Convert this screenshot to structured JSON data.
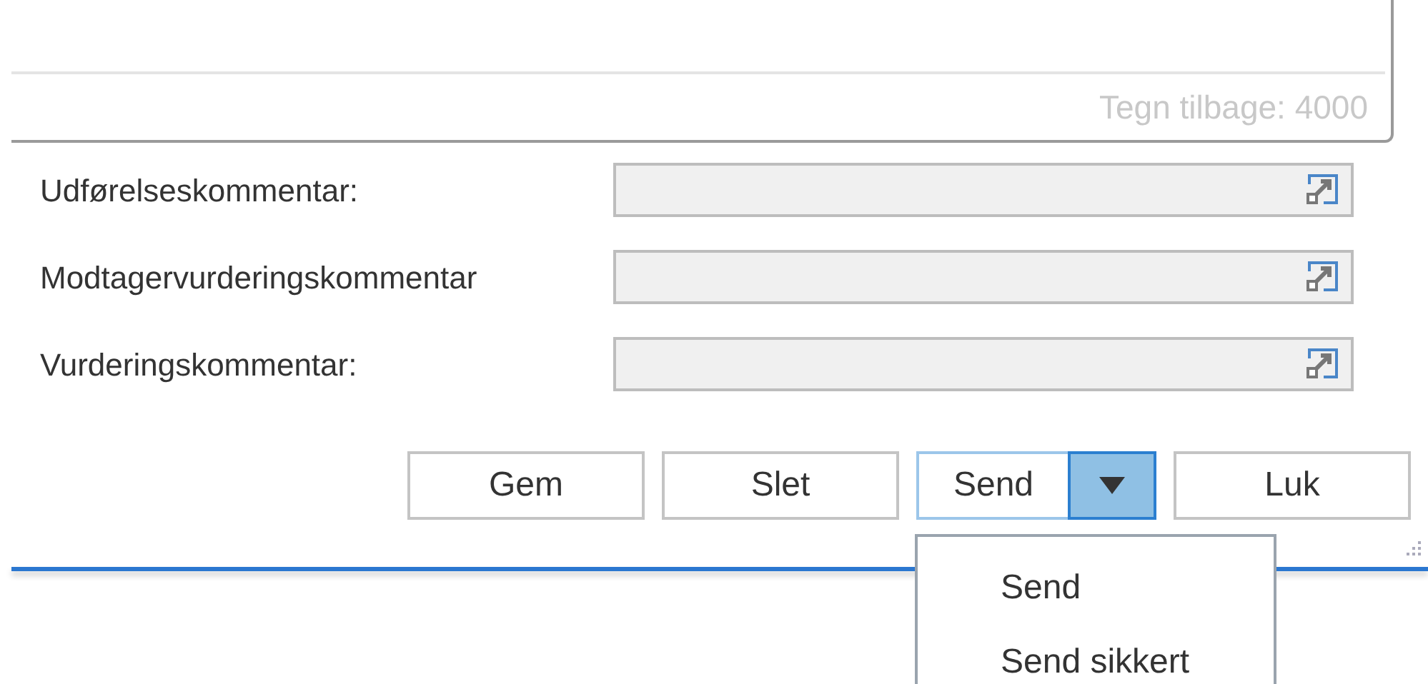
{
  "comment_box": {
    "counter": "Tegn tilbage: 4000"
  },
  "fields": [
    {
      "label": "Udførelseskommentar:"
    },
    {
      "label": "Modtagervurderingskommentar"
    },
    {
      "label": "Vurderingskommentar:"
    }
  ],
  "buttons": [
    {
      "kind": "plain",
      "label": "Gem"
    },
    {
      "kind": "plain",
      "label": "Slet"
    },
    {
      "kind": "split",
      "label": "Send",
      "expanded": true
    },
    {
      "kind": "plain",
      "label": "Luk"
    }
  ],
  "send_menu": {
    "items": [
      {
        "label": "Send"
      },
      {
        "label": "Send sikkert"
      }
    ]
  }
}
